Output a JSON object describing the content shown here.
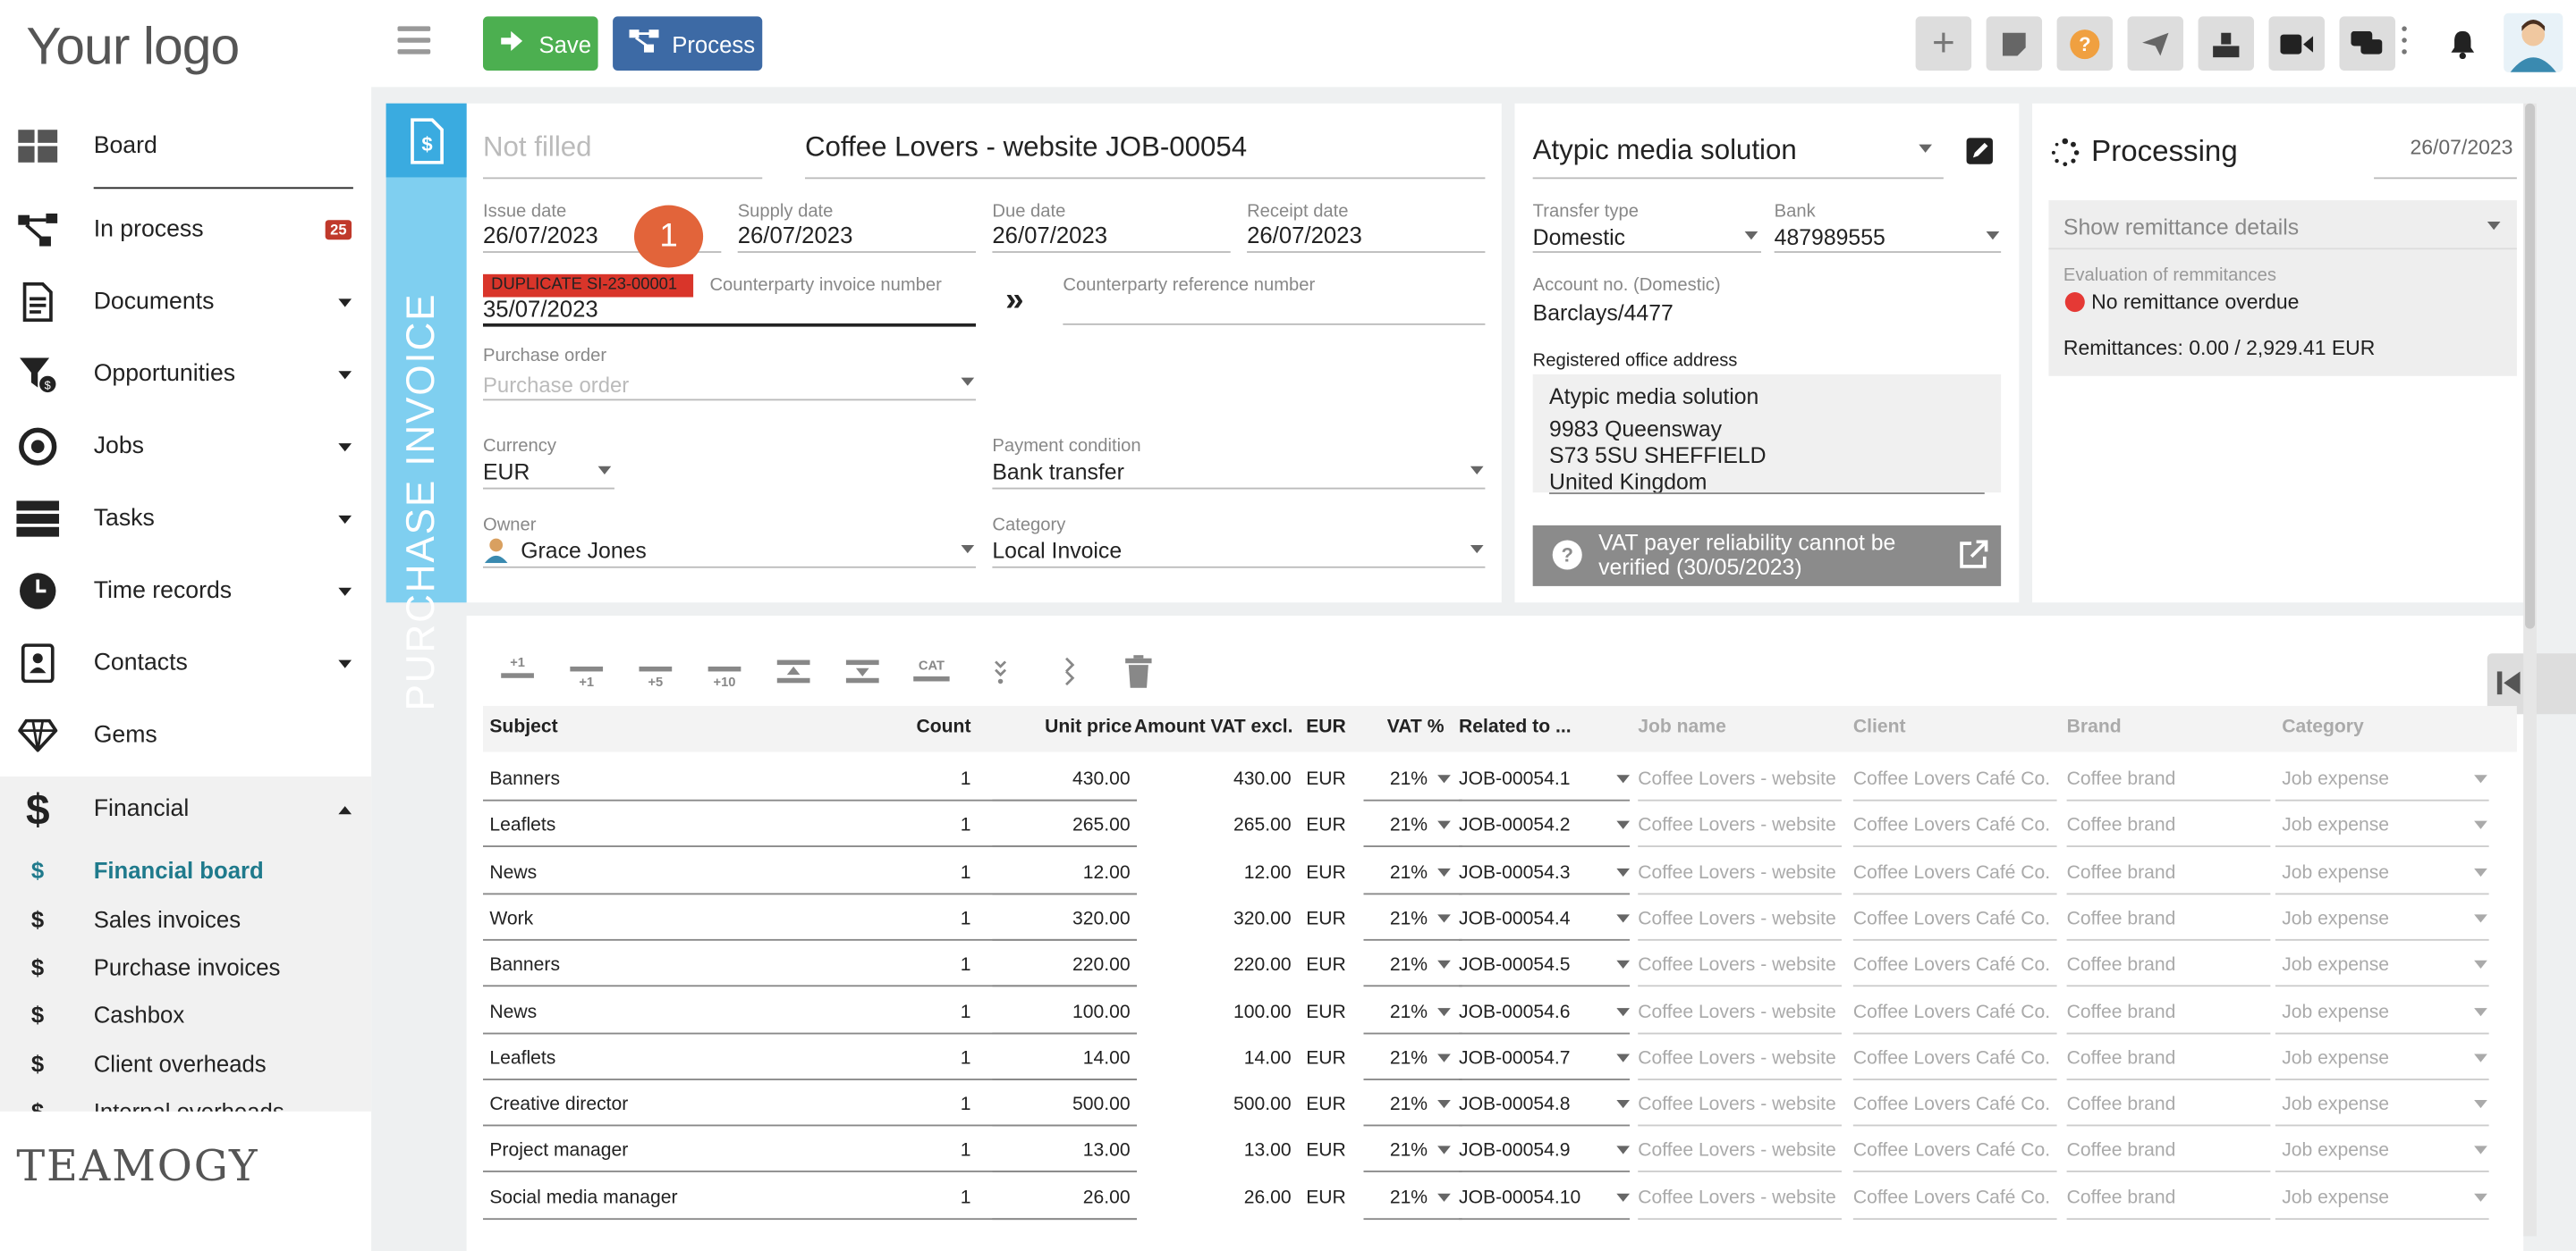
{
  "sidebar": {
    "logo": "Your logo",
    "nav": [
      {
        "label": "Board",
        "icon": "board-icon"
      },
      {
        "label": "In process",
        "icon": "process-icon",
        "badge": "25"
      },
      {
        "label": "Documents",
        "icon": "document-icon"
      },
      {
        "label": "Opportunities",
        "icon": "funnel-icon"
      },
      {
        "label": "Jobs",
        "icon": "target-icon"
      },
      {
        "label": "Tasks",
        "icon": "tasks-icon"
      },
      {
        "label": "Time records",
        "icon": "clock-icon"
      },
      {
        "label": "Contacts",
        "icon": "contacts-icon"
      },
      {
        "label": "Gems",
        "icon": "gem-icon"
      },
      {
        "label": "Financial",
        "icon": "dollar-icon"
      }
    ],
    "financial_sub": [
      {
        "label": "Financial board"
      },
      {
        "label": "Sales invoices"
      },
      {
        "label": "Purchase invoices"
      },
      {
        "label": "Cashbox"
      },
      {
        "label": "Client overheads"
      },
      {
        "label": "Internal overheads"
      }
    ],
    "sub_symbol": "$",
    "brand": "TEAMOGY"
  },
  "toolbar": {
    "save_label": "Save",
    "process_label": "Process",
    "help_label": "?"
  },
  "invoice": {
    "side_label": "PURCHASE INVOICE",
    "number_placeholder": "Not filled",
    "title": "Coffee Lovers - website JOB-00054",
    "issue_date_label": "Issue date",
    "issue_date": "26/07/2023",
    "supply_date_label": "Supply date",
    "supply_date": "26/07/2023",
    "due_date_label": "Due date",
    "due_date": "26/07/2023",
    "receipt_date_label": "Receipt date",
    "receipt_date": "26/07/2023",
    "step_badge": "1",
    "duplicate_warning": "DUPLICATE SI-23-00001",
    "counterparty_invoice_label": "Counterparty invoice number",
    "counterparty_invoice_value": "35/07/2023",
    "counterparty_reference_label": "Counterparty reference number",
    "purchase_order_label": "Purchase order",
    "purchase_order_placeholder": "Purchase order",
    "currency_label": "Currency",
    "currency": "EUR",
    "payment_condition_label": "Payment condition",
    "payment_condition": "Bank transfer",
    "owner_label": "Owner",
    "owner": "Grace Jones",
    "category_label": "Category",
    "category": "Local Invoice"
  },
  "supplier": {
    "name": "Atypic media solution",
    "transfer_type_label": "Transfer type",
    "transfer_type": "Domestic",
    "bank_label": "Bank",
    "bank": "487989555",
    "account_label": "Account no. (Domestic)",
    "account": "Barclays/4477",
    "address_label": "Registered office address",
    "address_lines": [
      "Atypic media solution",
      "9983 Queensway",
      "S73 5SU SHEFFIELD",
      "United Kingdom"
    ],
    "vat_notice_line1": "VAT payer reliability cannot be",
    "vat_notice_line2": "verified (30/05/2023)"
  },
  "status": {
    "label": "Processing",
    "date": "26/07/2023",
    "remittance_toggle": "Show remittance details",
    "evaluation_label": "Evaluation of remmitances",
    "evaluation_value": "No remittance overdue",
    "evaluation_color": "#e53935",
    "remittances": "Remittances: 0.00 / 2,929.41 EUR"
  },
  "table_toolbar": [
    "+1",
    "+1",
    "+5",
    "+10",
    "",
    "",
    "CAT",
    "",
    "",
    ""
  ],
  "table": {
    "headers": [
      "Subject",
      "Count",
      "Unit price",
      "Amount VAT excl.",
      "EUR",
      "VAT %",
      "Related to ...",
      "Job name",
      "Client",
      "Brand",
      "Category"
    ],
    "rows": [
      {
        "subject": "Banners",
        "count": "1",
        "unit": "430.00",
        "amount": "430.00",
        "cur": "EUR",
        "vat": "21%",
        "rel": "JOB-00054.1",
        "job": "Coffee Lovers - website",
        "client": "Coffee Lovers Café Co.",
        "brand": "Coffee brand",
        "cat": "Job expense"
      },
      {
        "subject": "Leaflets",
        "count": "1",
        "unit": "265.00",
        "amount": "265.00",
        "cur": "EUR",
        "vat": "21%",
        "rel": "JOB-00054.2",
        "job": "Coffee Lovers - website",
        "client": "Coffee Lovers Café Co.",
        "brand": "Coffee brand",
        "cat": "Job expense"
      },
      {
        "subject": "News",
        "count": "1",
        "unit": "12.00",
        "amount": "12.00",
        "cur": "EUR",
        "vat": "21%",
        "rel": "JOB-00054.3",
        "job": "Coffee Lovers - website",
        "client": "Coffee Lovers Café Co.",
        "brand": "Coffee brand",
        "cat": "Job expense"
      },
      {
        "subject": "Work",
        "count": "1",
        "unit": "320.00",
        "amount": "320.00",
        "cur": "EUR",
        "vat": "21%",
        "rel": "JOB-00054.4",
        "job": "Coffee Lovers - website",
        "client": "Coffee Lovers Café Co.",
        "brand": "Coffee brand",
        "cat": "Job expense"
      },
      {
        "subject": "Banners",
        "count": "1",
        "unit": "220.00",
        "amount": "220.00",
        "cur": "EUR",
        "vat": "21%",
        "rel": "JOB-00054.5",
        "job": "Coffee Lovers - website",
        "client": "Coffee Lovers Café Co.",
        "brand": "Coffee brand",
        "cat": "Job expense"
      },
      {
        "subject": "News",
        "count": "1",
        "unit": "100.00",
        "amount": "100.00",
        "cur": "EUR",
        "vat": "21%",
        "rel": "JOB-00054.6",
        "job": "Coffee Lovers - website",
        "client": "Coffee Lovers Café Co.",
        "brand": "Coffee brand",
        "cat": "Job expense"
      },
      {
        "subject": "Leaflets",
        "count": "1",
        "unit": "14.00",
        "amount": "14.00",
        "cur": "EUR",
        "vat": "21%",
        "rel": "JOB-00054.7",
        "job": "Coffee Lovers - website",
        "client": "Coffee Lovers Café Co.",
        "brand": "Coffee brand",
        "cat": "Job expense"
      },
      {
        "subject": "Creative director",
        "count": "1",
        "unit": "500.00",
        "amount": "500.00",
        "cur": "EUR",
        "vat": "21%",
        "rel": "JOB-00054.8",
        "job": "Coffee Lovers - website",
        "client": "Coffee Lovers Café Co.",
        "brand": "Coffee brand",
        "cat": "Job expense"
      },
      {
        "subject": "Project manager",
        "count": "1",
        "unit": "13.00",
        "amount": "13.00",
        "cur": "EUR",
        "vat": "21%",
        "rel": "JOB-00054.9",
        "job": "Coffee Lovers - website",
        "client": "Coffee Lovers Café Co.",
        "brand": "Coffee brand",
        "cat": "Job expense"
      },
      {
        "subject": "Social media manager",
        "count": "1",
        "unit": "26.00",
        "amount": "26.00",
        "cur": "EUR",
        "vat": "21%",
        "rel": "JOB-00054.10",
        "job": "Coffee Lovers - website",
        "client": "Coffee Lovers Café Co.",
        "brand": "Coffee brand",
        "cat": "Job expense"
      }
    ]
  },
  "colors": {
    "save": "#4caf50",
    "process": "#3d6aa5",
    "accent": "#1f7a8c",
    "invoice_tab": "#7fcff0",
    "duplicate": "#d9352a",
    "step": "#e2643a"
  }
}
